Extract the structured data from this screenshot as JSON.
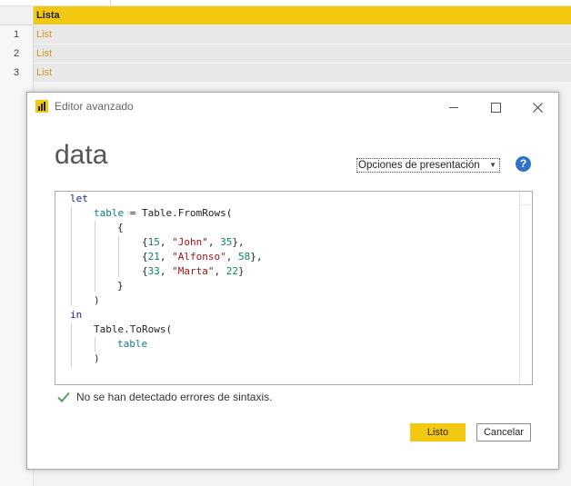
{
  "grid": {
    "column_header": "Lista",
    "rows": [
      {
        "num": "1",
        "value": "List"
      },
      {
        "num": "2",
        "value": "List"
      },
      {
        "num": "3",
        "value": "List"
      }
    ]
  },
  "dialog": {
    "title": "Editor avanzado",
    "query_name": "data",
    "display_options_label": "Opciones de presentación",
    "help_glyph": "?",
    "status_message": "No se han detectado errores de sintaxis.",
    "ok_label": "Listo",
    "cancel_label": "Cancelar"
  },
  "code": {
    "let": "let",
    "table_var": "table",
    "eq": " = ",
    "fromrows": "Table.FromRows(",
    "open_brace": "{",
    "r1_open": "{",
    "r1_n1": "15",
    "r1_s": "\"John\"",
    "r1_n2": "35",
    "r1_close": "},",
    "r2_open": "{",
    "r2_n1": "21",
    "r2_s": "\"Alfonso\"",
    "r2_n2": "58",
    "r2_close": "},",
    "r3_open": "{",
    "r3_n1": "33",
    "r3_s": "\"Marta\"",
    "r3_n2": "22",
    "r3_close": "}",
    "comma_sp": ", ",
    "close_brace": "}",
    "close_paren1": ")",
    "in": "in",
    "torows": "Table.ToRows(",
    "table_arg": "table",
    "close_paren2": ")"
  },
  "colors": {
    "accent": "#f2c811",
    "keyword": "#1a2aa3",
    "identifier": "#117b8a",
    "number": "#098658",
    "string": "#a31515",
    "cell_text": "#d99a12",
    "help": "#3072c8",
    "check": "#5b9a68"
  },
  "icons": {
    "app": "power-bi-icon",
    "minimize": "minimize-icon",
    "maximize": "maximize-icon",
    "close": "close-icon",
    "help": "help-icon",
    "dropdown": "chevron-down-icon",
    "status": "check-icon"
  }
}
